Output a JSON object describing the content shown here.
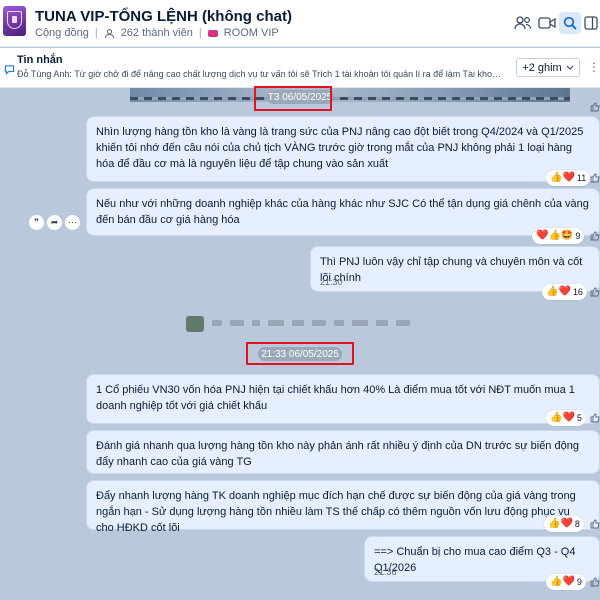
{
  "header": {
    "title": "TUNA VIP-TỔNG LỆNH (không chat)",
    "type_label": "Cộng đồng",
    "members": "262 thành viên",
    "room": "ROOM VIP"
  },
  "pinned": {
    "label": "Tin nhắn",
    "text": "Đỗ Tùng Anh: Từ giờ chở đi để nâng cao chất lượng dịch vụ tư vấn tôi sẽ Trích 1 tài khoản tôi quản lí ra để làm Tài khoản mẫu c...",
    "pins_button": "+2 ghim"
  },
  "date_chips": [
    "T3 06/05/2025",
    "21:33 06/05/2025"
  ],
  "messages": [
    {
      "text": "Nhìn lượng hàng tồn kho là vàng là trang sức của PNJ nâng cao đột biết trong Q4/2024 và Q1/2025 khiến tôi nhớ đến câu nói của chủ tịch VÀNG trước giờ trong mắt của PNJ không phải 1 loại hàng hóa để đầu cơ mà là nguyên liệu để tập chung vào sản xuất",
      "time": "",
      "reaction": {
        "emojis": "👍❤️",
        "count": "11"
      }
    },
    {
      "text": "Nếu như với những doanh nghiệp khác của hàng khác như SJC Có thể tận dụng giá chênh của vàng đến bán đầu cơ giá hàng hóa",
      "time": "",
      "reaction": {
        "emojis": "❤️👍🤩",
        "count": "9"
      }
    },
    {
      "text": "Thì PNJ luôn vậy chỉ tập chung và chuyên môn và cốt lõi chính",
      "time": "21:30",
      "reaction": {
        "emojis": "👍❤️",
        "count": "16"
      }
    },
    {
      "text": "1 Cổ phiếu VN30 vốn hóa PNJ hiện tại chiết khấu hơn 40% Là điểm mua tốt với NĐT muốn mua 1 doanh nghiệp tốt với giá chiết khấu",
      "time": "",
      "reaction": {
        "emojis": "👍❤️",
        "count": "5"
      }
    },
    {
      "text": "Đánh giá nhanh qua lượng hàng tồn kho này phản ánh rất nhiều ý định của DN trước sự biến động đẩy nhanh cao của giá vàng TG",
      "time": "",
      "reaction": null
    },
    {
      "text": "Đẩy nhanh lượng hàng TK doanh nghiệp mục đích hạn chế được sự biến động của giá vàng trong ngắn hạn - Sử dụng lượng hàng tồn nhiều làm TS thế chấp có thêm nguồn vốn lưu động phục vụ cho HĐKD cốt lõi",
      "time": "",
      "reaction": {
        "emojis": "👍❤️",
        "count": "8"
      }
    },
    {
      "text": "==> Chuẩn bị cho mua cao điểm Q3 - Q4 Q1/2026",
      "time": "21:36",
      "reaction": {
        "emojis": "👍❤️",
        "count": "9"
      }
    }
  ],
  "colors": {
    "bubble": "#e5efff",
    "chat_bg": "#b9c9db",
    "highlight_box": "#e0141e",
    "accent": "#0068ff"
  }
}
